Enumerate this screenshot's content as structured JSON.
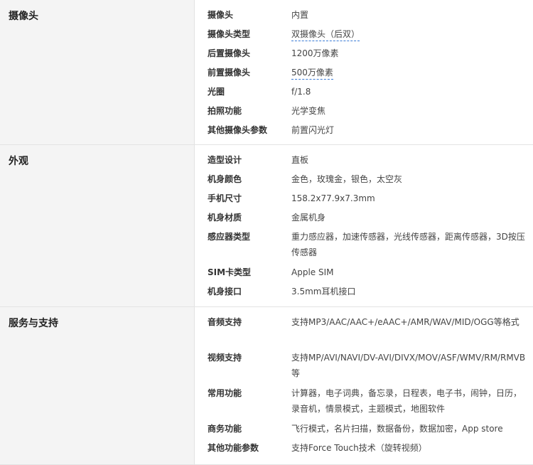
{
  "sections": [
    {
      "title": "摄像头",
      "rows": [
        {
          "label": "摄像头",
          "value": "内置"
        },
        {
          "label": "摄像头类型",
          "value": "双摄像头（后双）",
          "underline": true
        },
        {
          "label": "后置摄像头",
          "value": "1200万像素"
        },
        {
          "label": "前置摄像头",
          "value": "500万像素",
          "underline": true
        },
        {
          "label": "光圈",
          "value": "f/1.8"
        },
        {
          "label": "拍照功能",
          "value": "光学变焦"
        },
        {
          "label": "其他摄像头参数",
          "value": "前置闪光灯"
        }
      ]
    },
    {
      "title": "外观",
      "rows": [
        {
          "label": "造型设计",
          "value": "直板"
        },
        {
          "label": "机身颜色",
          "value": "金色，玫瑰金，银色，太空灰"
        },
        {
          "label": "手机尺寸",
          "value": "158.2x77.9x7.3mm"
        },
        {
          "label": "机身材质",
          "value": "金属机身"
        },
        {
          "label": "感应器类型",
          "value": "重力感应器，加速传感器，光线传感器，距离传感器，3D按压传感器"
        },
        {
          "label": "SIM卡类型",
          "value": "Apple SIM"
        },
        {
          "label": "机身接口",
          "value": "3.5mm耳机接口"
        }
      ]
    },
    {
      "title": "服务与支持",
      "rows": [
        {
          "label": "音频支持",
          "value": "支持MP3/AAC/AAC+/eAAC+/AMR/WAV/MID/OGG等格式"
        },
        {
          "label": "视频支持",
          "value": "支持MP/AVI/NAVI/DV-AVI/DIVX/MOV/ASF/WMV/RM/RMVB等"
        },
        {
          "label": "常用功能",
          "value": "计算器，电子词典，备忘录，日程表，电子书，闹钟，日历，录音机，情景模式，主题模式，地图软件"
        },
        {
          "label": "商务功能",
          "value": "飞行模式，名片扫描，数据备份，数据加密，App store"
        },
        {
          "label": "其他功能参数",
          "value": "支持Force Touch技术（旋转视频）"
        }
      ]
    }
  ]
}
